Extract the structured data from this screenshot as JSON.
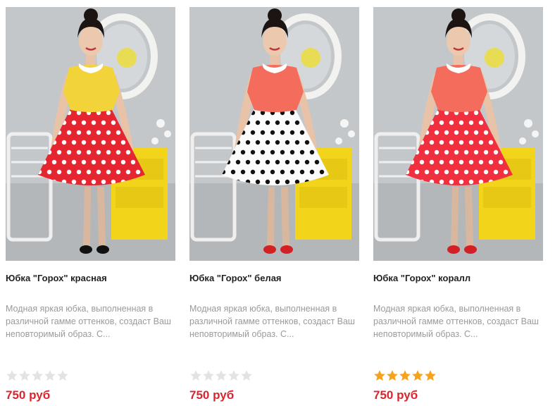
{
  "products": [
    {
      "title": "Юбка \"Горох\" красная",
      "description": "Модная яркая юбка, выполненная в различной гамме оттенков, создаст Ваш неповторимый образ. С...",
      "price": "750 руб",
      "rating": 0,
      "rating_max": 5,
      "photo": {
        "blouse_color": "#f3d33a",
        "skirt_color": "#e52630",
        "dot_color": "#ffffff",
        "shoe_color": "#111111"
      }
    },
    {
      "title": "Юбка \"Горох\" белая",
      "description": "Модная яркая юбка, выполненная в различной гамме оттенков, создаст Ваш неповторимый образ. С...",
      "price": "750 руб",
      "rating": 0,
      "rating_max": 5,
      "photo": {
        "blouse_color": "#f46c5c",
        "skirt_color": "#fbfbfb",
        "dot_color": "#111111",
        "shoe_color": "#d31f26"
      }
    },
    {
      "title": "Юбка \"Горох\" коралл",
      "description": "Модная яркая юбка, выполненная в различной гамме оттенков, создаст Ваш неповторимый образ. С...",
      "price": "750 руб",
      "rating": 5,
      "rating_max": 5,
      "photo": {
        "blouse_color": "#f46c5c",
        "skirt_color": "#f0303e",
        "dot_color": "#ffffff",
        "shoe_color": "#d31f26"
      }
    }
  ],
  "colors": {
    "star_filled": "#f7a21b",
    "star_empty": "#e3e3e3",
    "price": "#d8262e"
  }
}
